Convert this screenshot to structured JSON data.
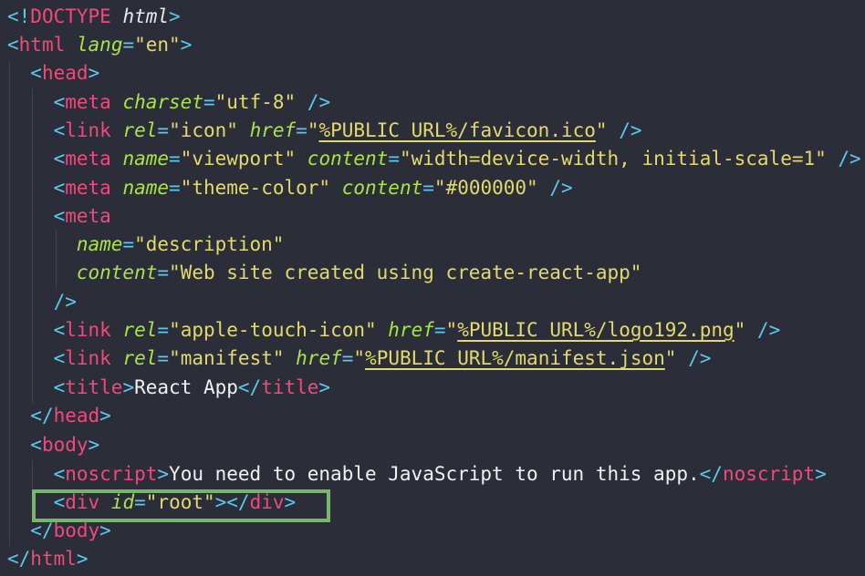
{
  "code": {
    "l1": {
      "bang": "<!",
      "doctype": "DOCTYPE",
      "html": "html",
      "close": ">"
    },
    "l2": {
      "open": "<",
      "tag": "html",
      "attr": "lang",
      "eq": "=",
      "val": "\"en\"",
      "close": ">"
    },
    "l3": {
      "open": "<",
      "tag": "head",
      "close": ">"
    },
    "l4": {
      "open": "<",
      "tag": "meta",
      "attr": "charset",
      "eq": "=",
      "val": "\"utf-8\"",
      "close": " />"
    },
    "l5": {
      "open": "<",
      "tag": "link",
      "attr1": "rel",
      "eq1": "=",
      "val1": "\"icon\"",
      "attr2": "href",
      "eq2": "=",
      "q1": "\"",
      "val2": "%PUBLIC_URL%/favicon.ico",
      "q2": "\"",
      "close": " />"
    },
    "l6": {
      "open": "<",
      "tag": "meta",
      "attr1": "name",
      "eq1": "=",
      "val1": "\"viewport\"",
      "attr2": "content",
      "eq2": "=",
      "val2": "\"width=device-width, initial-scale=1\"",
      "close": " />"
    },
    "l7": {
      "open": "<",
      "tag": "meta",
      "attr1": "name",
      "eq1": "=",
      "val1": "\"theme-color\"",
      "attr2": "content",
      "eq2": "=",
      "val2": "\"#000000\"",
      "close": " />"
    },
    "l8": {
      "open": "<",
      "tag": "meta"
    },
    "l9": {
      "attr": "name",
      "eq": "=",
      "val": "\"description\""
    },
    "l10": {
      "attr": "content",
      "eq": "=",
      "val": "\"Web site created using create-react-app\""
    },
    "l11": {
      "close": "/>"
    },
    "l12": {
      "open": "<",
      "tag": "link",
      "attr1": "rel",
      "eq1": "=",
      "val1": "\"apple-touch-icon\"",
      "attr2": "href",
      "eq2": "=",
      "q1": "\"",
      "val2": "%PUBLIC_URL%/logo192.png",
      "q2": "\"",
      "close": " />"
    },
    "l13": {
      "open": "<",
      "tag": "link",
      "attr1": "rel",
      "eq1": "=",
      "val1": "\"manifest\"",
      "attr2": "href",
      "eq2": "=",
      "q1": "\"",
      "val2": "%PUBLIC_URL%/manifest.json",
      "q2": "\"",
      "close": " />"
    },
    "l14": {
      "open": "<",
      "tag": "title",
      "gt": ">",
      "text": "React App",
      "endopen": "</",
      "endtag": "title",
      "close": ">"
    },
    "l15": {
      "open": "</",
      "tag": "head",
      "close": ">"
    },
    "l16": {
      "open": "<",
      "tag": "body",
      "close": ">"
    },
    "l17": {
      "open": "<",
      "tag": "noscript",
      "gt": ">",
      "text": "You need to enable JavaScript to run this app.",
      "endopen": "</",
      "endtag": "noscript",
      "close": ">"
    },
    "l18": {
      "open": "<",
      "tag": "div",
      "attr": "id",
      "eq": "=",
      "val": "\"root\"",
      "gt": "></",
      "endtag": "div",
      "close": ">"
    },
    "l19": {
      "open": "</",
      "tag": "body",
      "close": ">"
    },
    "l20": {
      "open": "</",
      "tag": "html",
      "close": ">"
    }
  },
  "colors": {
    "background": "#2b2e39",
    "tag": "#f0497c",
    "attribute": "#a8e34a",
    "string": "#e4d96c",
    "punctuation": "#5bc8ec",
    "highlight_box": "#78b56c"
  }
}
